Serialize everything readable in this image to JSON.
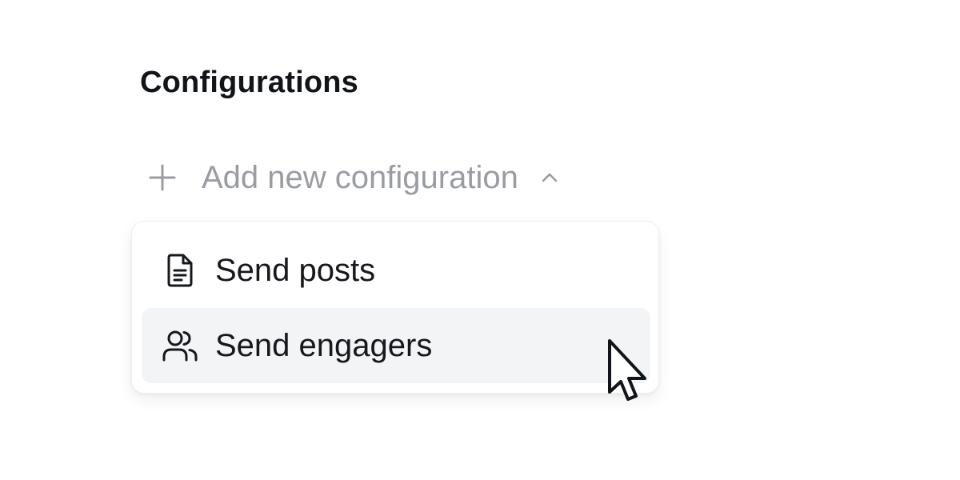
{
  "section": {
    "title": "Configurations"
  },
  "add_configuration": {
    "label": "Add new configuration",
    "icon": "plus-icon",
    "toggle_icon": "chevron-up-icon",
    "expanded": true
  },
  "menu": {
    "items": [
      {
        "label": "Send posts",
        "icon": "document-icon",
        "hovered": false
      },
      {
        "label": "Send engagers",
        "icon": "users-icon",
        "hovered": true
      }
    ]
  },
  "colors": {
    "title": "#111418",
    "muted_text": "#9a9ca3",
    "item_text": "#16181d",
    "hover_background": "#f3f4f6",
    "menu_border": "#eceef1"
  }
}
